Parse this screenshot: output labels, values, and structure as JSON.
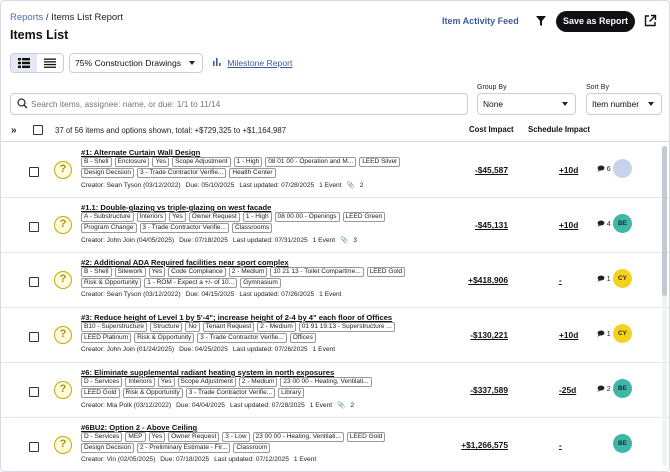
{
  "header": {
    "breadcrumb_root": "Reports",
    "breadcrumb_sep": "/",
    "breadcrumb_current": "Items List Report",
    "title": "Items List",
    "activity_feed": "Item Activity Feed",
    "save_report": "Save as Report"
  },
  "toolbar": {
    "drawing": "75% Construction Drawings",
    "milestone_report": "Milestone Report"
  },
  "search": {
    "placeholder": "Search items, assignee: name, or due: 1/1 to 11/14"
  },
  "group_by": {
    "label": "Group By",
    "value": "None"
  },
  "sort_by": {
    "label": "Sort By",
    "value": "Item number"
  },
  "list_header": {
    "summary": "37 of 56 items and options shown, total: +$729,325 to +$1,164,987",
    "cost_impact": "Cost Impact",
    "schedule_impact": "Schedule Impact"
  },
  "colors": {
    "accent": "#3d5d99",
    "avatar_teal": "#3fb6a6",
    "avatar_yellow": "#f5d21f",
    "question_yellow": "#c8a800"
  },
  "rows": [
    {
      "title": "#1: Alternate Curtain Wall Design",
      "tags_line1": [
        "B - Shell",
        "Enclosure",
        "Yes",
        "Scope Adjustment",
        "1 - High",
        "08 01 00 - Operation and M...",
        "LEED Silver"
      ],
      "tags_line2": [
        "Design Decision",
        "3 - Trade Contractor Verifie...",
        "Health Center"
      ],
      "creator": "Creator: Sean Tyson (03/12/2022)",
      "due": "Due: 05/10/2025",
      "updated": "Last updated: 07/28/2025",
      "events": "1 Event",
      "attachments": "2",
      "cost": "-$45,587",
      "schedule": "+10d",
      "comments": "6",
      "avatar": "",
      "avatar_color": "#c7d3ea"
    },
    {
      "title": "#1.1: Double-glazing vs triple-glazing on west facade",
      "tags_line1": [
        "A - Substructure",
        "Interiors",
        "Yes",
        "Owner Request",
        "1 - High",
        "08 00 00 - Openings",
        "LEED Green"
      ],
      "tags_line2": [
        "Program Change",
        "3 - Trade Contractor Verifie...",
        "Classrooms"
      ],
      "creator": "Creator: John Join (04/05/2025)",
      "due": "Due: 07/18/2025",
      "updated": "Last updated: 07/31/2025",
      "events": "1 Event",
      "attachments": "3",
      "cost": "-$45,131",
      "schedule": "+10d",
      "comments": "4",
      "avatar": "BE",
      "avatar_color": "#3fb6a6"
    },
    {
      "title": "#2: Additional ADA Required facilities near sport complex",
      "tags_line1": [
        "B - Shell",
        "Sitework",
        "Yes",
        "Code Compliance",
        "2 - Medium",
        "10 21 13 - Toilet Compartme...",
        "LEED Gold"
      ],
      "tags_line2": [
        "Risk & Opportunity",
        "1 - ROM - Expect a +/- of 10...",
        "Gymnasium"
      ],
      "creator": "Creator: Sean Tyson (03/12/2022)",
      "due": "Due: 04/15/2025",
      "updated": "Last updated: 07/26/2025",
      "events": "1 Event",
      "attachments": "",
      "cost": "+$418,906",
      "schedule": "-",
      "comments": "1",
      "avatar": "CY",
      "avatar_color": "#f5d21f"
    },
    {
      "title": "#3: Reduce height of Level 1 by 5'-4\"; increase height of 2-4 by 4\" each floor of Offices",
      "tags_line1": [
        "B10 - Superstructure",
        "Structure",
        "No",
        "Tenant Request",
        "2 - Medium",
        "01 91 19.13 - Superstructure ..."
      ],
      "tags_line2": [
        "LEED Platinum",
        "Risk & Opportunity",
        "3 - Trade Contractor Verifie...",
        "Offices"
      ],
      "creator": "Creator: John Join (01/24/2025)",
      "due": "Due: 04/25/2025",
      "updated": "Last updated: 07/26/2025",
      "events": "1 Event",
      "attachments": "",
      "cost": "-$130,221",
      "schedule": "+10d",
      "comments": "1",
      "avatar": "CY",
      "avatar_color": "#f5d21f"
    },
    {
      "title": "#6: Eliminate supplemental radiant heating system in north exposures",
      "tags_line1": [
        "D - Services",
        "Interiors",
        "Yes",
        "Scope Adjustment",
        "2 - Medium",
        "23 00 00 - Heating, Ventilati..."
      ],
      "tags_line2": [
        "LEED Gold",
        "Risk & Opportunity",
        "3 - Trade Contractor Verifie...",
        "Library"
      ],
      "creator": "Creator: Mia Polk (03/12/2022)",
      "due": "Due: 04/04/2025",
      "updated": "Last updated: 07/28/2025",
      "events": "1 Event",
      "attachments": "2",
      "cost": "-$337,589",
      "schedule": "-25d",
      "comments": "2",
      "avatar": "BE",
      "avatar_color": "#3fb6a6"
    },
    {
      "title": "#6BU2: Option 2 - Above Ceiling",
      "tags_line1": [
        "D - Services",
        "MEP",
        "Yes",
        "Owner Request",
        "3 - Low",
        "23 00 00 - Heating, Ventilati...",
        "LEED Gold"
      ],
      "tags_line2": [
        "Design Decision",
        "2 - Preliminary Estimate - Fir...",
        "Classroom"
      ],
      "creator": "Creator: Vin (02/05/2025)",
      "due": "Due: 07/18/2025",
      "updated": "Last updated: 07/12/2025",
      "events": "1 Event",
      "attachments": "",
      "cost": "+$1,266,575",
      "schedule": "-",
      "comments": "",
      "avatar": "BE",
      "avatar_color": "#3fb6a6"
    }
  ]
}
